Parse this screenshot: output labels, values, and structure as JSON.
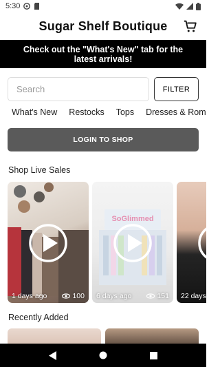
{
  "status_bar": {
    "time": "5:30"
  },
  "header": {
    "title": "Sugar Shelf Boutique"
  },
  "banner": {
    "text": "Check out the \"What's New\" tab for the latest arrivals!"
  },
  "search": {
    "placeholder": "Search",
    "value": "",
    "filter_label": "FILTER"
  },
  "tabs": [
    "What's New",
    "Restocks",
    "Tops",
    "Dresses & Rompers"
  ],
  "login_label": "LOGIN TO SHOP",
  "live_sales": {
    "title": "Shop Live Sales",
    "items": [
      {
        "age": "1 days ago",
        "views": "100"
      },
      {
        "age": "6 days ago",
        "views": "151"
      },
      {
        "age": "22 days"
      }
    ]
  },
  "recently_added": {
    "title": "Recently Added"
  },
  "product_text": "SoGlimmed",
  "colors": {
    "banner_bg": "#000000",
    "login_bg": "#5a5a5a",
    "nav_bg": "#000000"
  }
}
